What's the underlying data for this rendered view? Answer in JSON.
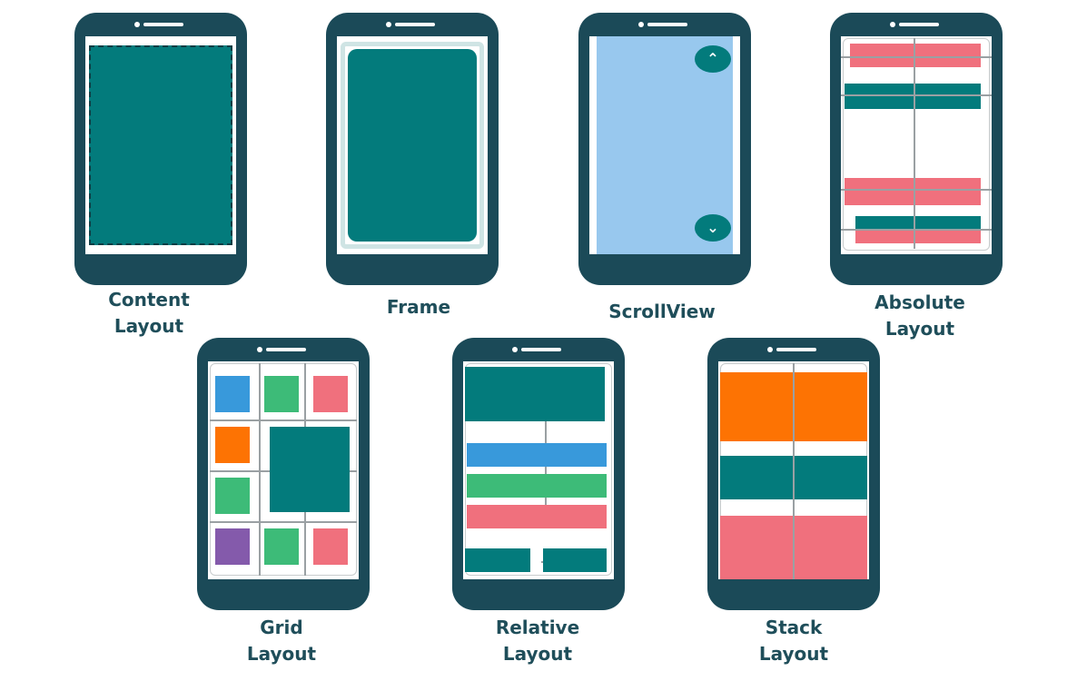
{
  "colors": {
    "phone_body": "#1b4a58",
    "teal": "#037b7c",
    "pink": "#f0707d",
    "blue": "#3899db",
    "green": "#3dbb78",
    "orange": "#fd7303",
    "purple": "#845aab",
    "sky": "#98c8ee"
  },
  "layouts": [
    {
      "id": "content",
      "label_line1": "Content",
      "label_line2": "Layout"
    },
    {
      "id": "frame",
      "label_line1": "Frame",
      "label_line2": ""
    },
    {
      "id": "scrollview",
      "label_line1": "ScrollView",
      "label_line2": "",
      "up_icon": "chevron-up-icon",
      "down_icon": "chevron-down-icon"
    },
    {
      "id": "absolute",
      "label_line1": "Absolute",
      "label_line2": "Layout"
    },
    {
      "id": "grid",
      "label_line1": "Grid",
      "label_line2": "Layout"
    },
    {
      "id": "relative",
      "label_line1": "Relative",
      "label_line2": "Layout"
    },
    {
      "id": "stack",
      "label_line1": "Stack",
      "label_line2": "Layout"
    }
  ]
}
